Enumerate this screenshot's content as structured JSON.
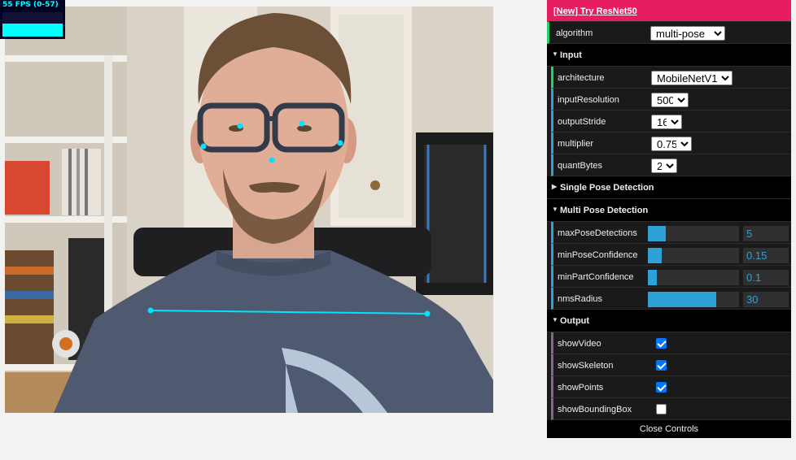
{
  "fps": {
    "text": "55 FPS (0-57)",
    "level": 0.55
  },
  "gui": {
    "new_link": "[New] Try ResNet50",
    "algorithm": {
      "label": "algorithm",
      "value": "multi-pose"
    },
    "input": {
      "title": "Input",
      "architecture": {
        "label": "architecture",
        "value": "MobileNetV1"
      },
      "inputResolution": {
        "label": "inputResolution",
        "value": "500"
      },
      "outputStride": {
        "label": "outputStride",
        "value": "16"
      },
      "multiplier": {
        "label": "multiplier",
        "value": "0.75"
      },
      "quantBytes": {
        "label": "quantBytes",
        "value": "2"
      }
    },
    "single": {
      "title": "Single Pose Detection"
    },
    "multi": {
      "title": "Multi Pose Detection",
      "maxPoseDetections": {
        "label": "maxPoseDetections",
        "value": "5",
        "fraction": 0.2
      },
      "minPoseConfidence": {
        "label": "minPoseConfidence",
        "value": "0.15",
        "fraction": 0.15
      },
      "minPartConfidence": {
        "label": "minPartConfidence",
        "value": "0.1",
        "fraction": 0.1
      },
      "nmsRadius": {
        "label": "nmsRadius",
        "value": "30",
        "fraction": 0.75
      }
    },
    "output": {
      "title": "Output",
      "showVideo": {
        "label": "showVideo",
        "checked": true
      },
      "showSkeleton": {
        "label": "showSkeleton",
        "checked": true
      },
      "showPoints": {
        "label": "showPoints",
        "checked": true
      },
      "showBoundingBox": {
        "label": "showBoundingBox",
        "checked": false
      }
    },
    "close": "Close Controls"
  },
  "colors": {
    "accent": "#2fa1d6",
    "link_bg": "#e61d5f",
    "keypoint": "#00e5ff"
  }
}
